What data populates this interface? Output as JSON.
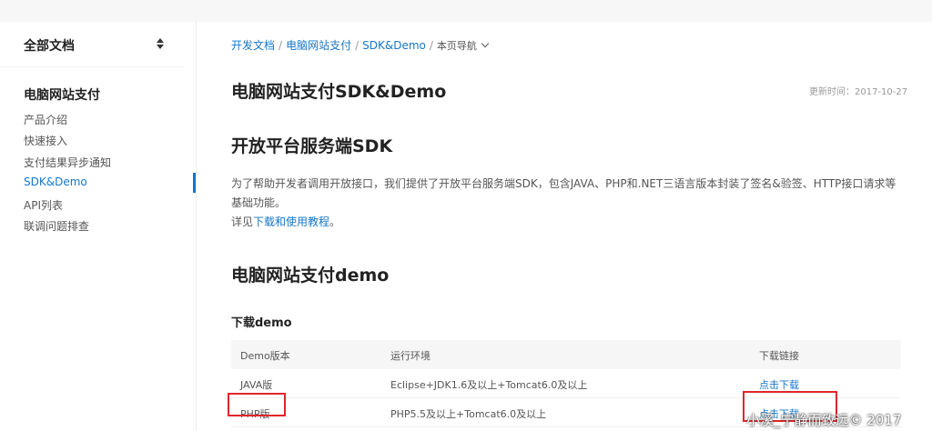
{
  "sidebar": {
    "title": "全部文档",
    "section": "电脑网站支付",
    "items": [
      {
        "label": "产品介绍"
      },
      {
        "label": "快速接入"
      },
      {
        "label": "支付结果异步通知"
      },
      {
        "label": "SDK&Demo"
      },
      {
        "label": "API列表"
      },
      {
        "label": "联调问题排查"
      }
    ],
    "active_index": 3
  },
  "breadcrumb": {
    "items": [
      "开发文档",
      "电脑网站支付",
      "SDK&Demo"
    ],
    "separator": "/",
    "page_nav": "本页导航"
  },
  "page": {
    "title": "电脑网站支付SDK&Demo",
    "updated": "更新时间：2017-10-27"
  },
  "sdk": {
    "heading": "开放平台服务端SDK",
    "paragraph": "为了帮助开发者调用开放接口，我们提供了开放平台服务端SDK，包含JAVA、PHP和.NET三语言版本封装了签名&验签、HTTP接口请求等基础功能。",
    "see_prefix": "详见",
    "see_link": "下载和使用教程",
    "see_suffix": "。"
  },
  "demo": {
    "heading": "电脑网站支付demo",
    "subheading": "下载demo",
    "columns": [
      "Demo版本",
      "运行环境",
      "下载链接"
    ],
    "rows": [
      {
        "version": "JAVA版",
        "env": "Eclipse+JDK1.6及以上+Tomcat6.0及以上",
        "link": "点击下载"
      },
      {
        "version": "PHP版",
        "env": "PHP5.5及以上+Tomcat6.0及以上",
        "link": "点击下载"
      }
    ]
  },
  "watermark": "小溪_宁静而致远© 2017",
  "colors": {
    "link": "#1677c9",
    "highlight": "#e0262a"
  }
}
